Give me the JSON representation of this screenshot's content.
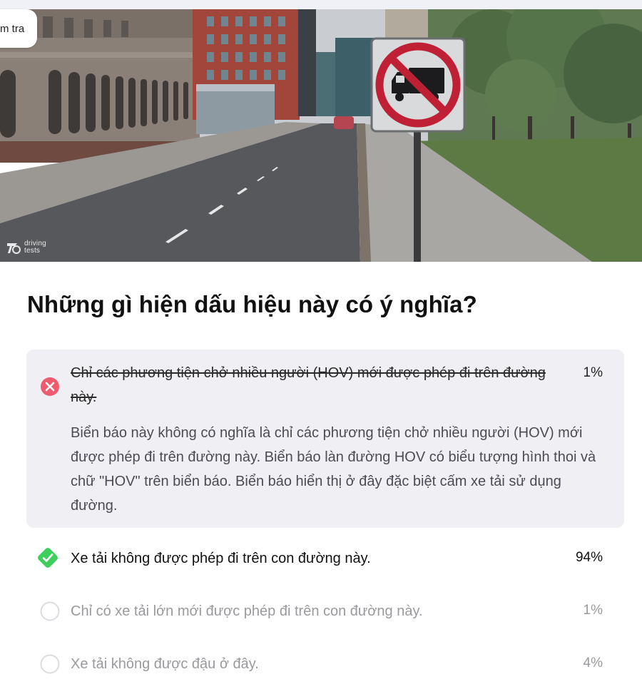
{
  "header": {
    "check_chip_label": "m tra"
  },
  "hero_image": {
    "description_icon": "no-trucks-sign-photo",
    "brand_line1": "driving",
    "brand_line2": "tests"
  },
  "question": {
    "text": "Những gì hiện dấu hiệu này có ý nghĩa?"
  },
  "answers": [
    {
      "status": "wrong",
      "icon": "x-circle-icon",
      "text": "Chỉ các phương tiện chở nhiều người (HOV) mới được phép đi trên đường này.",
      "percent": "1%",
      "explanation": "Biển báo này không có nghĩa là chỉ các phương tiện chở nhiều người (HOV) mới được phép đi trên đường này. Biển báo làn đường HOV có biểu tượng hình thoi và chữ \"HOV\" trên biển báo. Biển báo hiển thị ở đây đặc biệt cấm xe tải sử dụng đường."
    },
    {
      "status": "correct",
      "icon": "check-diamond-icon",
      "text": "Xe tải không được phép đi trên con đường này.",
      "percent": "94%"
    },
    {
      "status": "unselected",
      "icon": "empty-circle-icon",
      "text": "Chỉ có xe tải lớn mới được phép đi trên con đường này.",
      "percent": "1%"
    },
    {
      "status": "unselected",
      "icon": "empty-circle-icon",
      "text": "Xe tải không được đậu ở đây.",
      "percent": "4%"
    }
  ],
  "colors": {
    "wrong": "#ef5b6e",
    "correct": "#3ccf5a",
    "explanation_bg": "#f0f0f4",
    "muted_text": "#9a9a9e"
  }
}
